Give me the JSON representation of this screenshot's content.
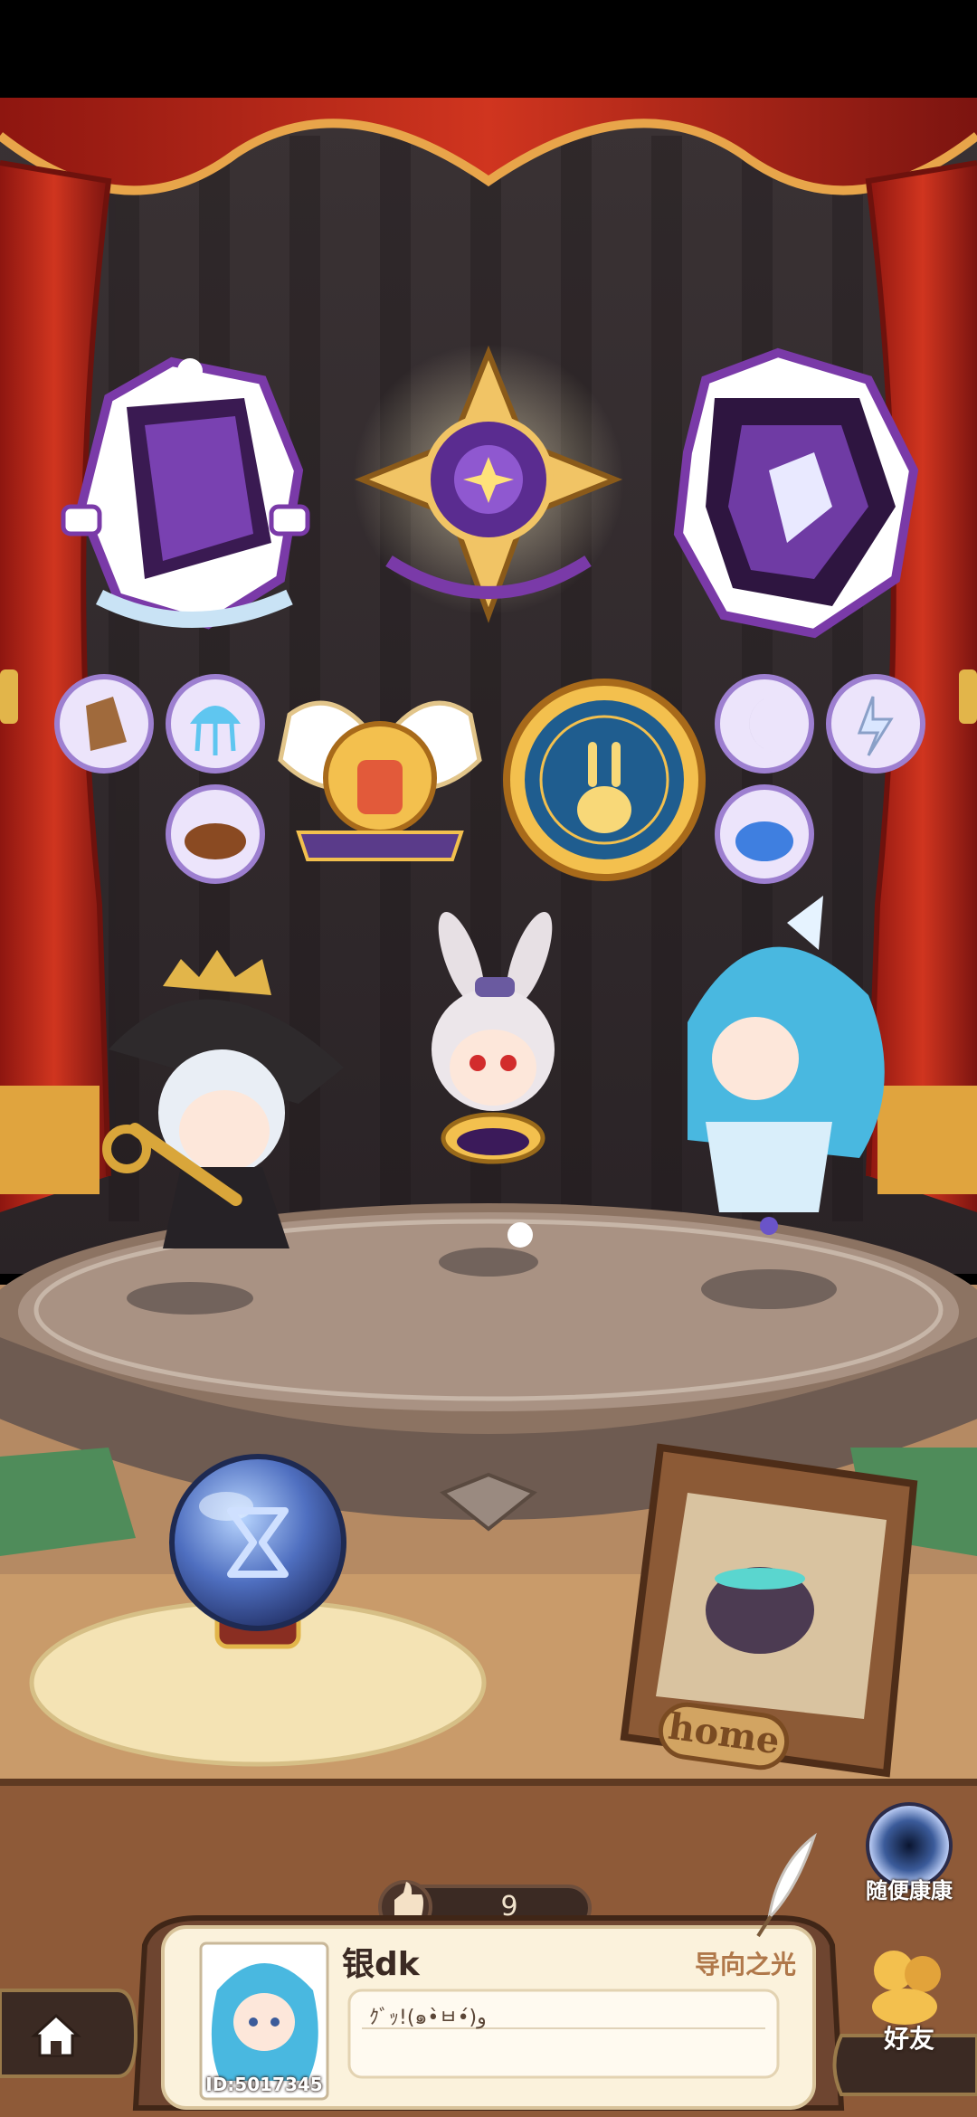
{
  "profile": {
    "likes": "9",
    "name": "银dk",
    "title": "导向之光",
    "signature": "ｸﾞｯ!(๑•̀ㅂ•́)و",
    "id_label": "ID:5017345"
  },
  "buttons": {
    "random_visit_label": "随便康康",
    "friends_label": "好友",
    "home_frame_label": "home"
  },
  "icons": {
    "home_button": "house-icon",
    "thumbs_up": "thumbs-up-icon",
    "crystal_ball": "hourglass-icon",
    "random_visit": "portal-icon",
    "friends": "friends-icon",
    "quill": "quill-icon"
  },
  "colors": {
    "curtain_red": "#c0281c",
    "stage_wood": "#8a5a36",
    "panel_cream": "#fbf2dc",
    "badge_purple": "#6a2e9c",
    "gold": "#e2b54a"
  }
}
